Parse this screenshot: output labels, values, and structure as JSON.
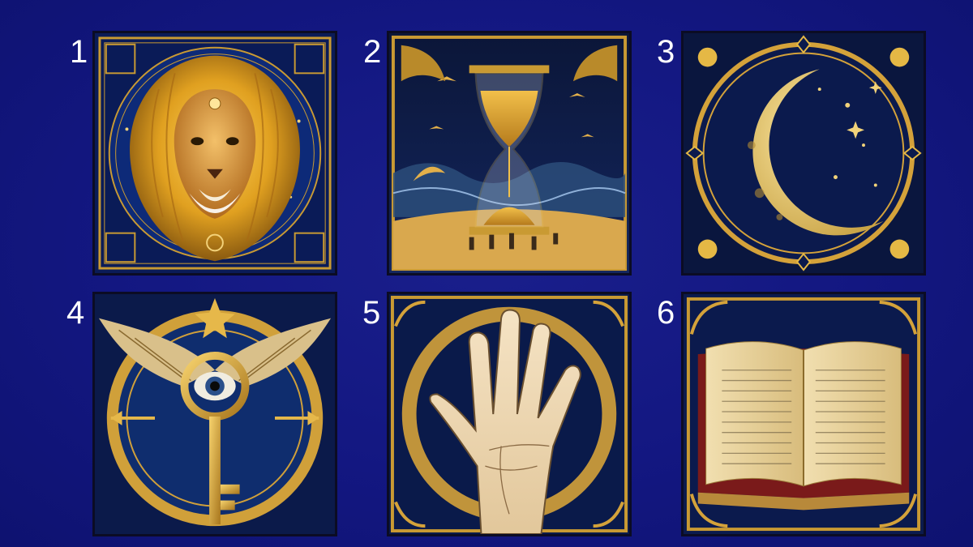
{
  "cards": [
    {
      "number": "1",
      "subject": "lion"
    },
    {
      "number": "2",
      "subject": "hourglass"
    },
    {
      "number": "3",
      "subject": "crescent-moon"
    },
    {
      "number": "4",
      "subject": "winged-eye-key"
    },
    {
      "number": "5",
      "subject": "palm-hand"
    },
    {
      "number": "6",
      "subject": "open-book"
    }
  ],
  "colors": {
    "background": "#131781",
    "gold": "#d8a93a",
    "navy": "#0a1a4a",
    "number": "#ffffff"
  }
}
